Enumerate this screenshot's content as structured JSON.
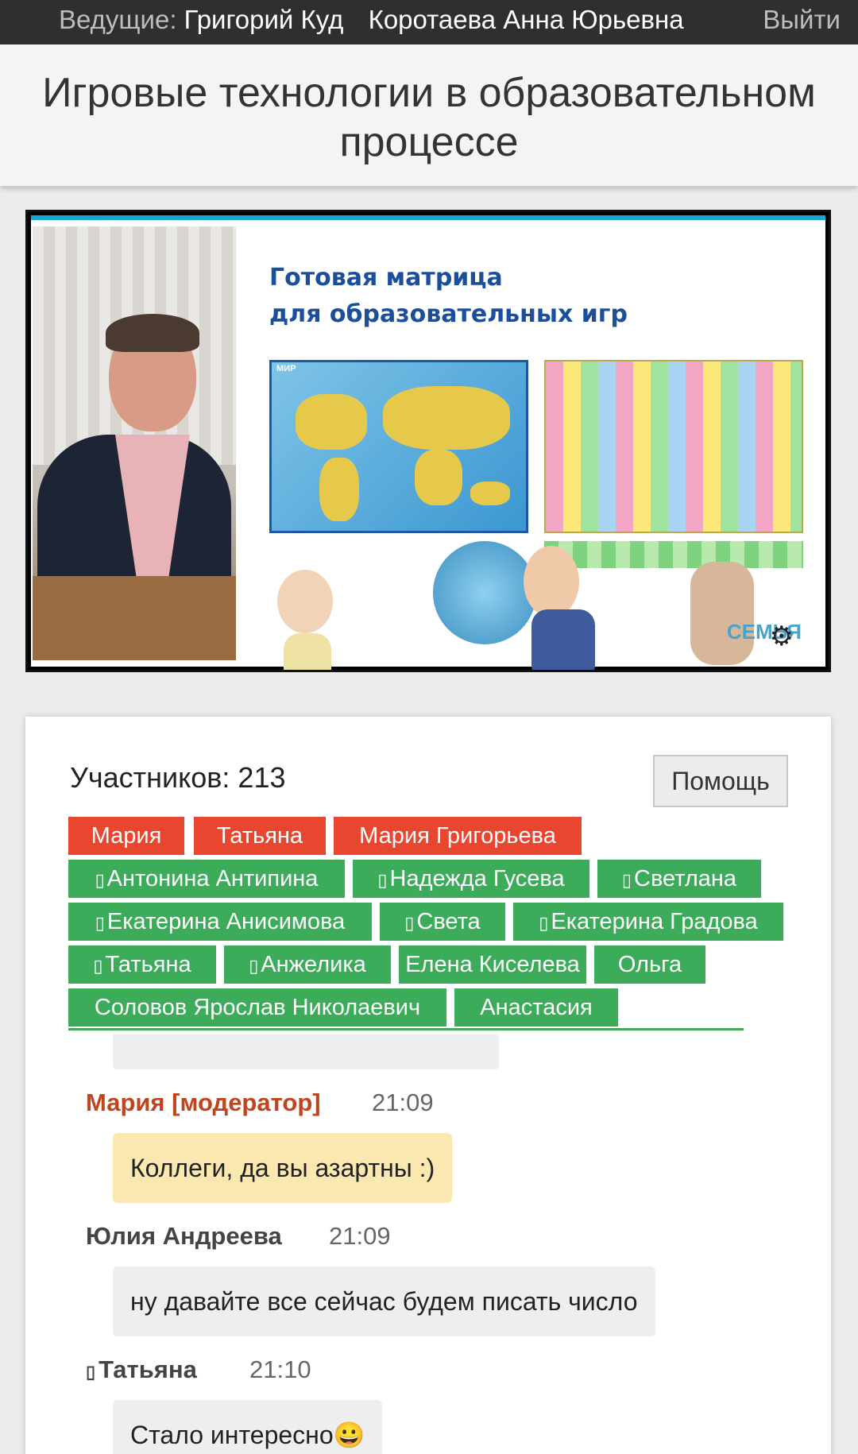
{
  "topbar": {
    "hosts_label": "Ведущие:",
    "hosts_names": "Григорий Куд",
    "host_2": "Коротаева Анна Юрьевна",
    "logout": "Выйти"
  },
  "page": {
    "title_line1": "Игровые технологии в образовательном",
    "title_line2": "процессе"
  },
  "video": {
    "slide_title_line1": "Готовая матрица",
    "slide_title_line2": "для образовательных игр",
    "map_label": "МИР",
    "logo_text": "СЕМЬЯ"
  },
  "participants": {
    "label": "Участников: 213",
    "help_label": "Помощь",
    "chips": [
      {
        "name": "Мария",
        "color": "#e8462e",
        "mobile": false
      },
      {
        "name": "Татьяна",
        "color": "#e8462e",
        "mobile": false
      },
      {
        "name": "Мария Григорьева",
        "color": "#e8462e",
        "mobile": false
      },
      {
        "name": "Антонина Антипина",
        "color": "#3cab5a",
        "mobile": true
      },
      {
        "name": "Надежда Гусева",
        "color": "#3cab5a",
        "mobile": true
      },
      {
        "name": "Светлана",
        "color": "#3cab5a",
        "mobile": true
      },
      {
        "name": "Екатерина Анисимова",
        "color": "#3cab5a",
        "mobile": true
      },
      {
        "name": "Света",
        "color": "#3cab5a",
        "mobile": true
      },
      {
        "name": "Екатерина Градова",
        "color": "#3cab5a",
        "mobile": true
      },
      {
        "name": "Татьяна",
        "color": "#3cab5a",
        "mobile": true
      },
      {
        "name": "Анжелика",
        "color": "#3cab5a",
        "mobile": true
      },
      {
        "name": "Елена Киселева",
        "color": "#3cab5a",
        "mobile": false
      },
      {
        "name": "Ольга",
        "color": "#3cab5a",
        "mobile": false
      },
      {
        "name": "Соловов Ярослав Николаевич",
        "color": "#3cab5a",
        "mobile": false
      },
      {
        "name": "Анастасия",
        "color": "#3cab5a",
        "mobile": false
      }
    ]
  },
  "chat": {
    "messages": [
      {
        "author": "Мария [модератор]",
        "time": "21:09",
        "text": "Коллеги, да вы азартны :)",
        "moderator": true,
        "mobile": false
      },
      {
        "author": "Юлия Андреева",
        "time": "21:09",
        "text": "ну давайте все сейчас будем писать число",
        "moderator": false,
        "mobile": false
      },
      {
        "author": "Татьяна",
        "time": "21:10",
        "text": "Стало интересно😀",
        "moderator": false,
        "mobile": true
      }
    ]
  },
  "colors": {
    "moderator_chip": "#e8462e",
    "participant_chip": "#3cab5a",
    "moderator_author": "#c0441f",
    "moderator_bubble": "#fbe8b0",
    "bubble": "#eeeeee"
  }
}
